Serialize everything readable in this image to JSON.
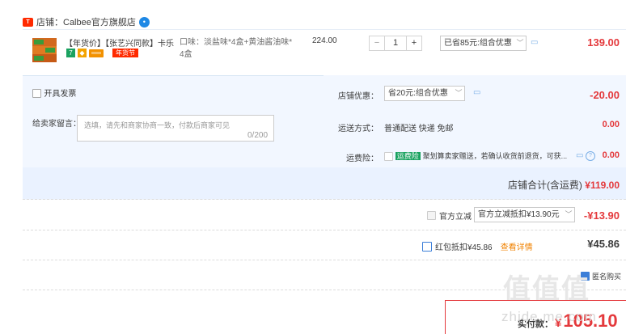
{
  "shop": {
    "label": "店铺：",
    "name": "Calbee官方旗舰店",
    "badge": "Tmall"
  },
  "item": {
    "title": "【年货价】【张艺兴同款】卡乐...",
    "sku_line1": "口味：淡盐味*4盒+黄油酱油味*",
    "sku_line2": "4盒",
    "unit_price": "224.00",
    "quantity": "1",
    "minus": "−",
    "plus": "+",
    "promo_select": "已省85元:组合优惠",
    "tag_newyear": "年货节",
    "tag_seven": "7",
    "row_total": "139.00"
  },
  "invoice": {
    "label": "开具发票"
  },
  "buyer_msg": {
    "label": "给卖家留言：",
    "placeholder": "选填，请先和商家协商一致，付款后商家可见",
    "count": "0/200"
  },
  "shop_discount": {
    "label": "店铺优惠：",
    "select": "省20元:组合优惠",
    "value": "-20.00"
  },
  "shipping": {
    "label": "运送方式：",
    "method": "普通配送 快递 免邮",
    "value": "0.00"
  },
  "freight_insurance": {
    "label": "运费险：",
    "badge": "运费险",
    "text": "聚划算卖家赠送，若确认收货前退货，可获...",
    "value": "0.00"
  },
  "shop_total": {
    "label": "店铺合计(含运费)",
    "value": "¥119.00"
  },
  "official": {
    "label": "官方立减",
    "select": "官方立减抵扣¥13.90元",
    "value": "-¥13.90"
  },
  "red_packet": {
    "label": "红包抵扣¥45.86",
    "link": "查看详情",
    "value": "¥45.86"
  },
  "anonymous": {
    "label": "匿名购买"
  },
  "pay": {
    "label": "实付款：",
    "currency": "¥",
    "value": "105.10"
  },
  "watermark": {
    "brand": "值值值",
    "url": "zhide.me.com"
  },
  "colors": {
    "accent": "#e4393c",
    "panel": "#f2f7ff",
    "total_bg": "#eaf2ff"
  }
}
